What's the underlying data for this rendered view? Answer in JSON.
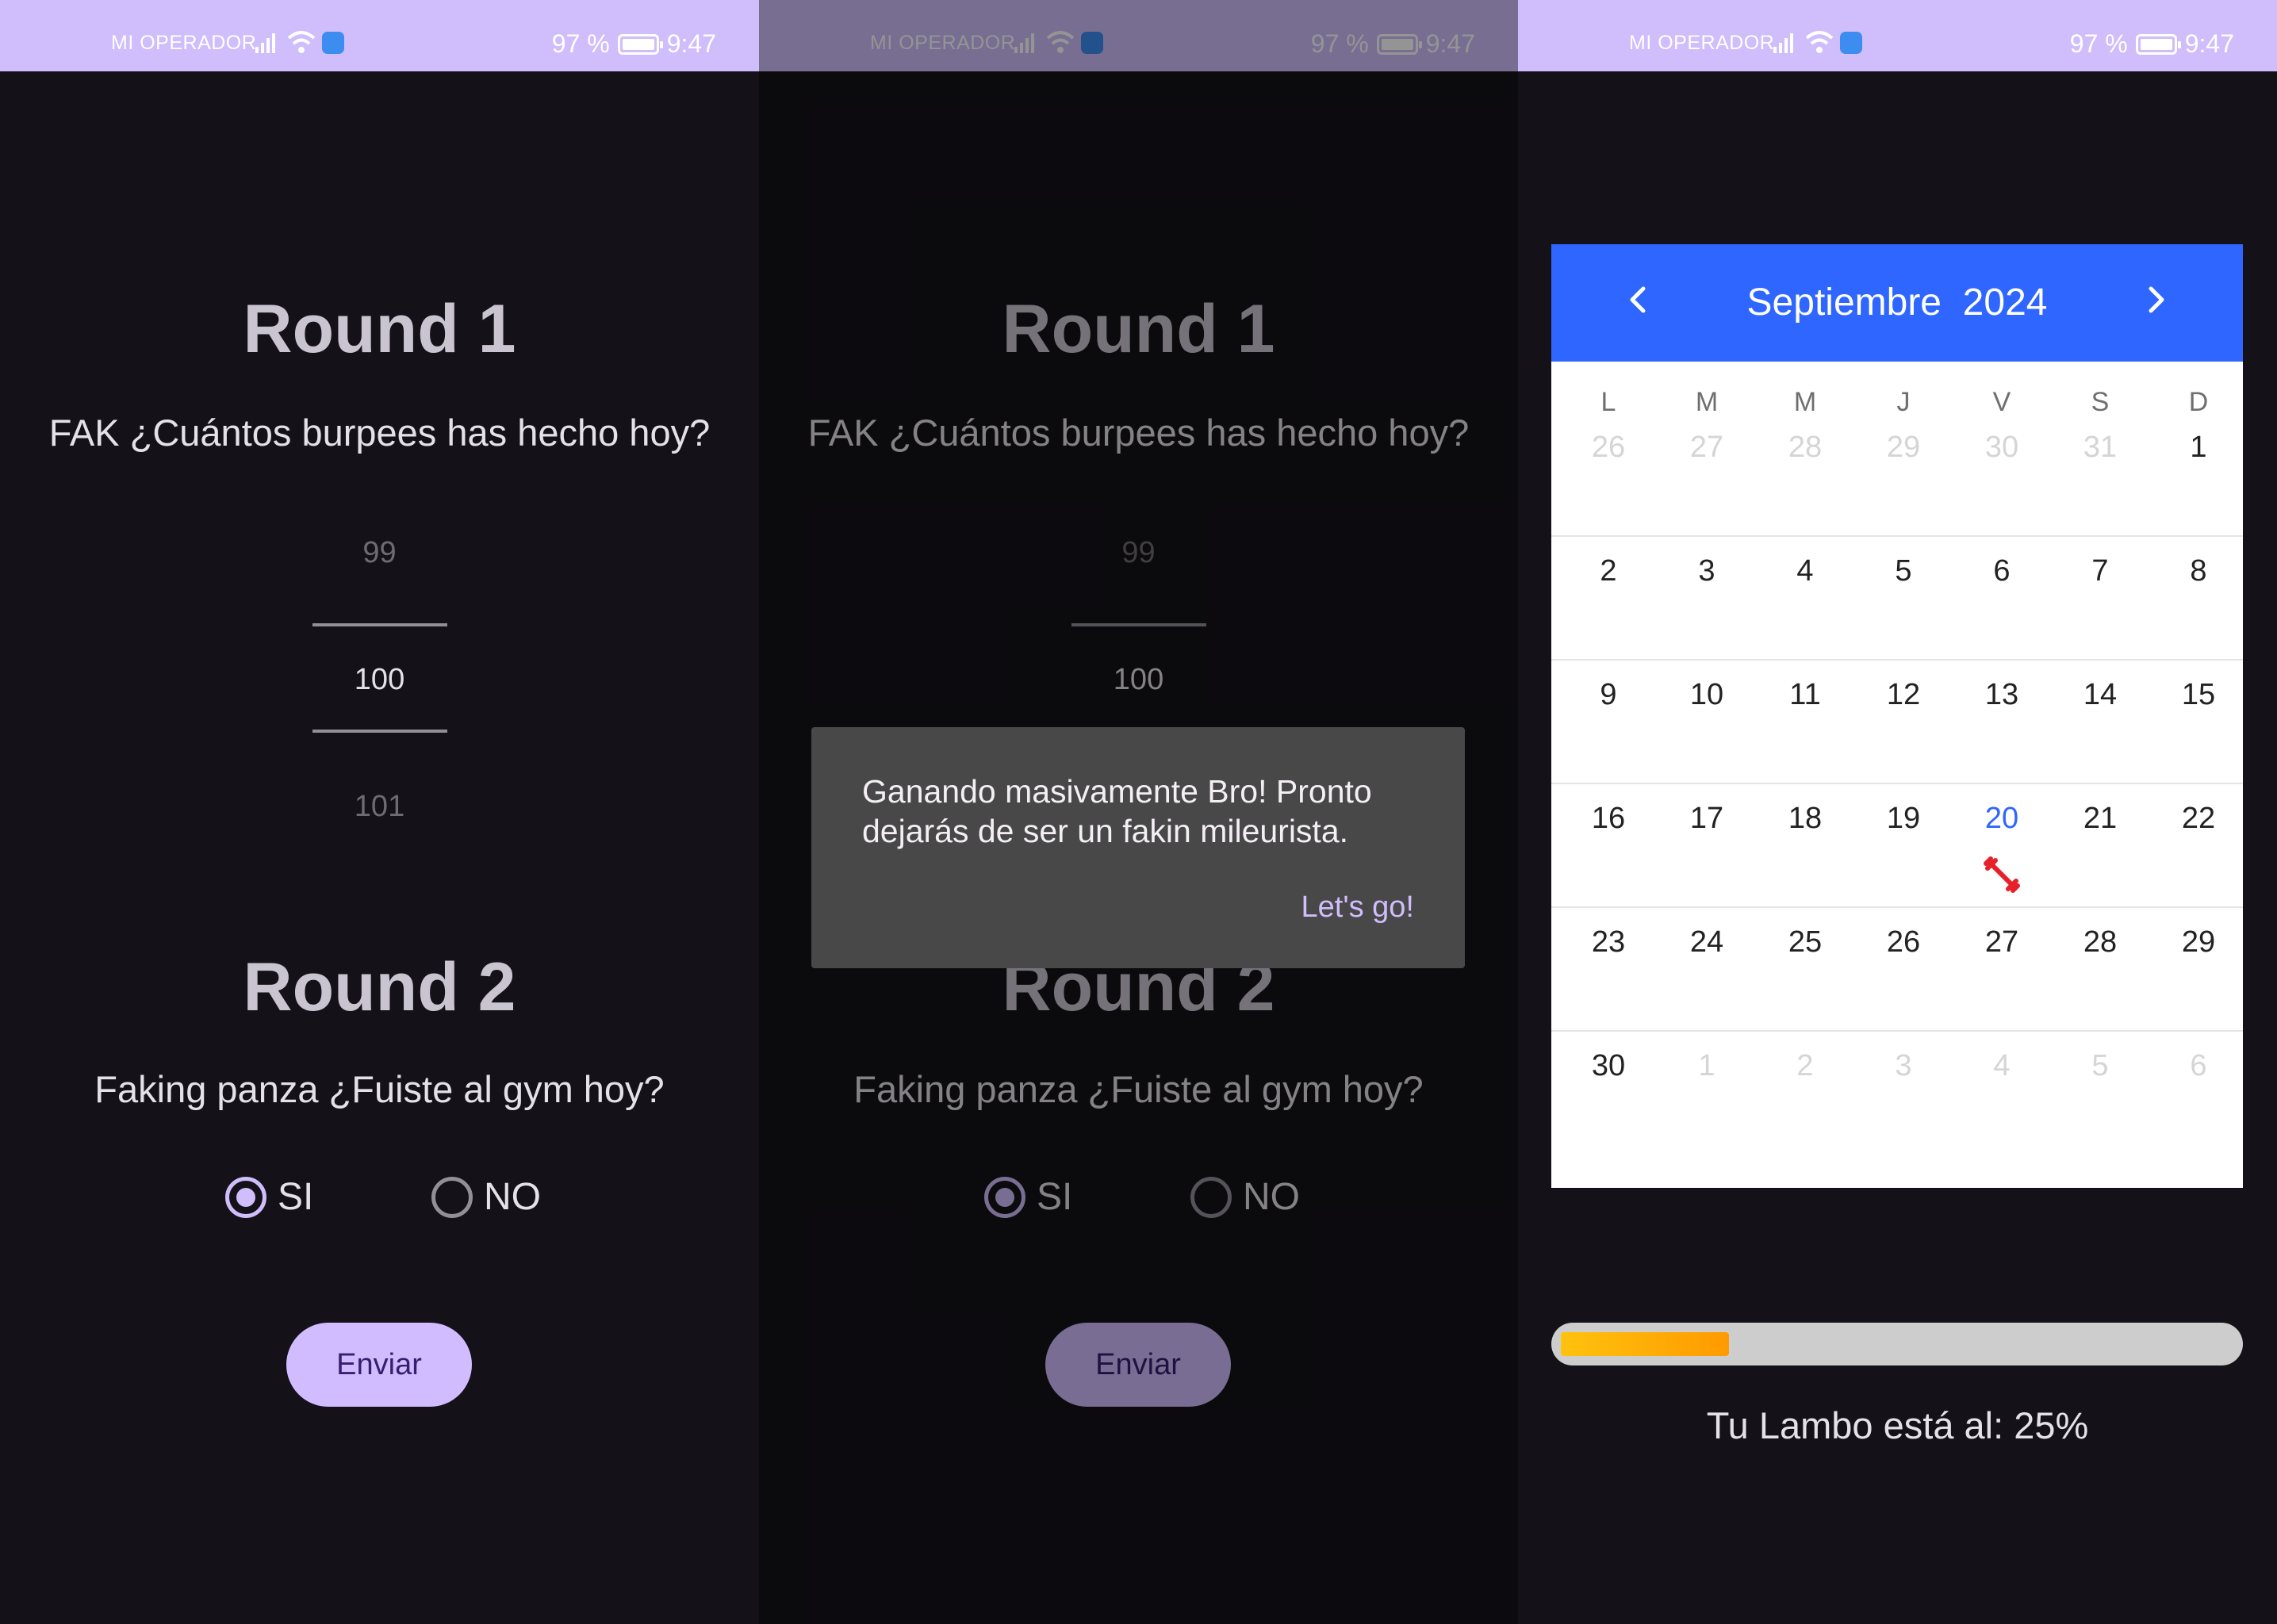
{
  "status_bar": {
    "carrier": "MI OPERADOR",
    "battery": "97 %",
    "time": "9:47"
  },
  "screen1": {
    "round1_title": "Round 1",
    "round1_question": "FAK ¿Cuántos burpees has hecho hoy?",
    "picker": {
      "prev": "99",
      "selected": "100",
      "next": "101"
    },
    "round2_title": "Round 2",
    "round2_question": "Faking panza ¿Fuiste al gym hoy?",
    "options": {
      "yes": "SI",
      "no": "NO",
      "selected": "SI"
    },
    "submit_label": "Enviar"
  },
  "screen2": {
    "round1_title": "Round 1",
    "round1_question": "FAK ¿Cuántos burpees has hecho hoy?",
    "picker": {
      "prev": "99",
      "selected": "100"
    },
    "round2_title": "Round 2",
    "round2_question": "Faking panza ¿Fuiste al gym hoy?",
    "options": {
      "yes": "SI",
      "no": "NO",
      "selected": "SI"
    },
    "submit_label": "Enviar",
    "snackbar": {
      "message": "Ganando masivamente Bro! Pronto dejarás de ser un fakin mileurista.",
      "action": "Let's go!"
    }
  },
  "screen3": {
    "calendar": {
      "month": "Septiembre",
      "year": "2024",
      "weekdays": [
        "L",
        "M",
        "M",
        "J",
        "V",
        "S",
        "D"
      ],
      "weeks": [
        [
          "26",
          "27",
          "28",
          "29",
          "30",
          "31",
          "1"
        ],
        [
          "2",
          "3",
          "4",
          "5",
          "6",
          "7",
          "8"
        ],
        [
          "9",
          "10",
          "11",
          "12",
          "13",
          "14",
          "15"
        ],
        [
          "16",
          "17",
          "18",
          "19",
          "20",
          "21",
          "22"
        ],
        [
          "23",
          "24",
          "25",
          "26",
          "27",
          "28",
          "29"
        ],
        [
          "30",
          "1",
          "2",
          "3",
          "4",
          "5",
          "6"
        ]
      ],
      "outside_month": [
        [
          0,
          0
        ],
        [
          0,
          1
        ],
        [
          0,
          2
        ],
        [
          0,
          3
        ],
        [
          0,
          4
        ],
        [
          0,
          5
        ],
        [
          5,
          1
        ],
        [
          5,
          2
        ],
        [
          5,
          3
        ],
        [
          5,
          4
        ],
        [
          5,
          5
        ],
        [
          5,
          6
        ]
      ],
      "today": "20",
      "gym_day_icon": "dumbbell-icon",
      "header_color": "#2e66ff"
    },
    "progress": {
      "value": 0.25,
      "label": "Tu Lambo está al: 25%"
    }
  },
  "colors": {
    "accent": "#cfbdfc",
    "background": "#141218",
    "progress": "#ffb000",
    "marker": "#e8202a"
  }
}
